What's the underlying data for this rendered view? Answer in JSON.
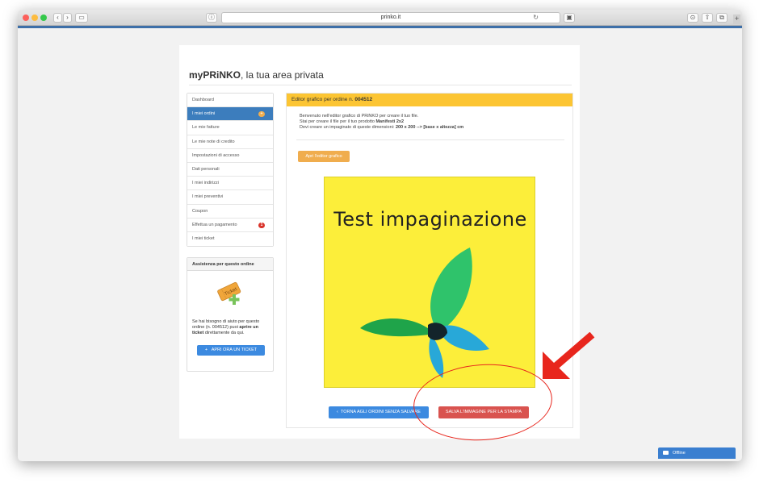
{
  "browser": {
    "url": "prinko.it",
    "back_label": "‹",
    "forward_label": "›",
    "sidebar_toggle": "▭",
    "info_label": "ⓘ",
    "reload_label": "↻",
    "extension_label": "▣",
    "download_label": "⊙",
    "share_label": "⇧",
    "tabs_label": "⧉",
    "new_tab_label": "+"
  },
  "page": {
    "brand": "myPRiNKO",
    "title_suffix": ", la tua area privata"
  },
  "menu": {
    "items": [
      {
        "label": "Dashboard"
      },
      {
        "label": "I miei ordini",
        "badge": "+"
      },
      {
        "label": "Le mie fatture"
      },
      {
        "label": "Le mie note di credito"
      },
      {
        "label": "Impostazioni di accesso"
      },
      {
        "label": "Dati personali"
      },
      {
        "label": "I miei indirizzi"
      },
      {
        "label": "I miei preventivi"
      },
      {
        "label": "Coupon"
      },
      {
        "label": "Effettua un pagamento",
        "badge": "1"
      },
      {
        "label": "I miei ticket"
      }
    ]
  },
  "help": {
    "heading": "Assistenza per questo ordine",
    "ticket_image_text": "Ticket",
    "text_1": "Se hai bisogno di aiuto per questo ordine (n. 004512) puoi ",
    "text_bold_1": "aprire un",
    "text_bold_2": "ticket",
    "text_2": " direttamente da qui.",
    "button_icon": "+",
    "button_label": "APRI ORA UN TICKET"
  },
  "panel": {
    "heading_prefix": "Editor grafico per ordine n. ",
    "order_number": "004512",
    "line1": "Benvenuto nell'editor grafico di PRiNKO per creare il tuo file.",
    "line2_prefix": "Stai per creare il file per il tuo prodotto ",
    "product": "Manifesti 2x2",
    "line3_prefix": "Devi creare un impaginato di queste dimensioni: ",
    "dimensions": "200 x 200 --> [base x altezza] cm",
    "editor_button": "Apri l'editor grafico",
    "canvas_text": "Test impaginazione",
    "back_icon": "‹",
    "back_button": "TORNA AGLI ORDINI SENZA SALVARE",
    "save_button": "SALVA L'IMMAGINE PER LA STAMPA"
  },
  "chat": {
    "label": "Offline"
  },
  "colors": {
    "header_yellow": "#fcc533",
    "active_blue": "#3c7dbd",
    "button_blue": "#3c8ae0",
    "button_red": "#d9534f",
    "button_orange": "#f0ad4e",
    "canvas_yellow": "#fcee3a",
    "annotation_red": "#e8261d"
  }
}
